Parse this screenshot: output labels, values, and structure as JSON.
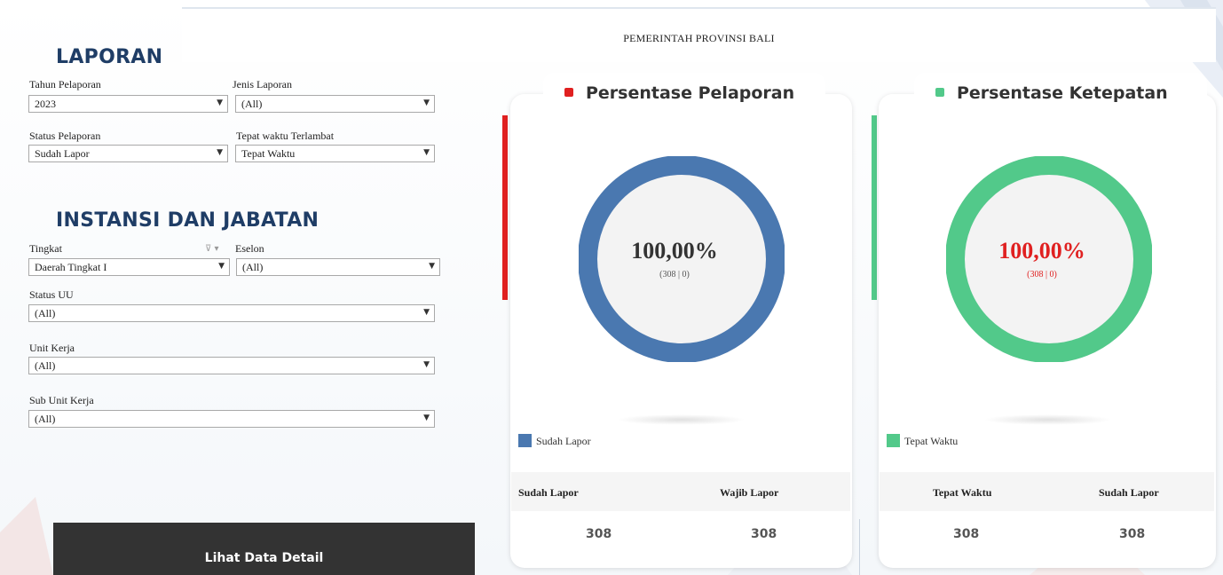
{
  "header": {
    "title": "PEMERINTAH PROVINSI BALI"
  },
  "laporan": {
    "section_title": "LAPORAN",
    "filters": [
      {
        "label": "Tahun Pelaporan",
        "value": "2023"
      },
      {
        "label": "Jenis Laporan",
        "value": "(All)"
      },
      {
        "label": "Status Pelaporan",
        "value": "Sudah Lapor"
      },
      {
        "label": "Tepat waktu Terlambat",
        "value": "Tepat Waktu"
      }
    ]
  },
  "instansi": {
    "section_title": "INSTANSI DAN JABATAN",
    "filters": [
      {
        "label": "Tingkat",
        "value": "Daerah Tingkat I"
      },
      {
        "label": "Eselon",
        "value": "(All)"
      },
      {
        "label": "Status UU",
        "value": "(All)"
      },
      {
        "label": "Unit Kerja",
        "value": "(All)"
      },
      {
        "label": "Sub Unit Kerja",
        "value": "(All)"
      }
    ]
  },
  "detail_button": {
    "label": "Lihat Data Detail"
  },
  "cards": [
    {
      "title": "Persentase Pelaporan",
      "accent_color": "#e02020",
      "ring_color": "#4a78b0",
      "value_color": "#333333",
      "percent": "100,00%",
      "sub": "(308 | 0)",
      "fill_fraction": 1.0,
      "legend_label": "Sudah Lapor",
      "columns": [
        "Sudah Lapor",
        "Wajib Lapor"
      ],
      "values": [
        "308",
        "308"
      ]
    },
    {
      "title": "Persentase Ketepatan",
      "accent_color": "#52c98a",
      "ring_color": "#52c98a",
      "value_color": "#e02020",
      "percent": "100,00%",
      "sub": "(308 | 0)",
      "fill_fraction": 1.0,
      "legend_label": "Tepat Waktu",
      "columns": [
        "Tepat Waktu",
        "Sudah Lapor"
      ],
      "values": [
        "308",
        "308"
      ]
    }
  ],
  "icons": {
    "dropdown": "caret-down-icon",
    "filter": "filter-icon"
  }
}
